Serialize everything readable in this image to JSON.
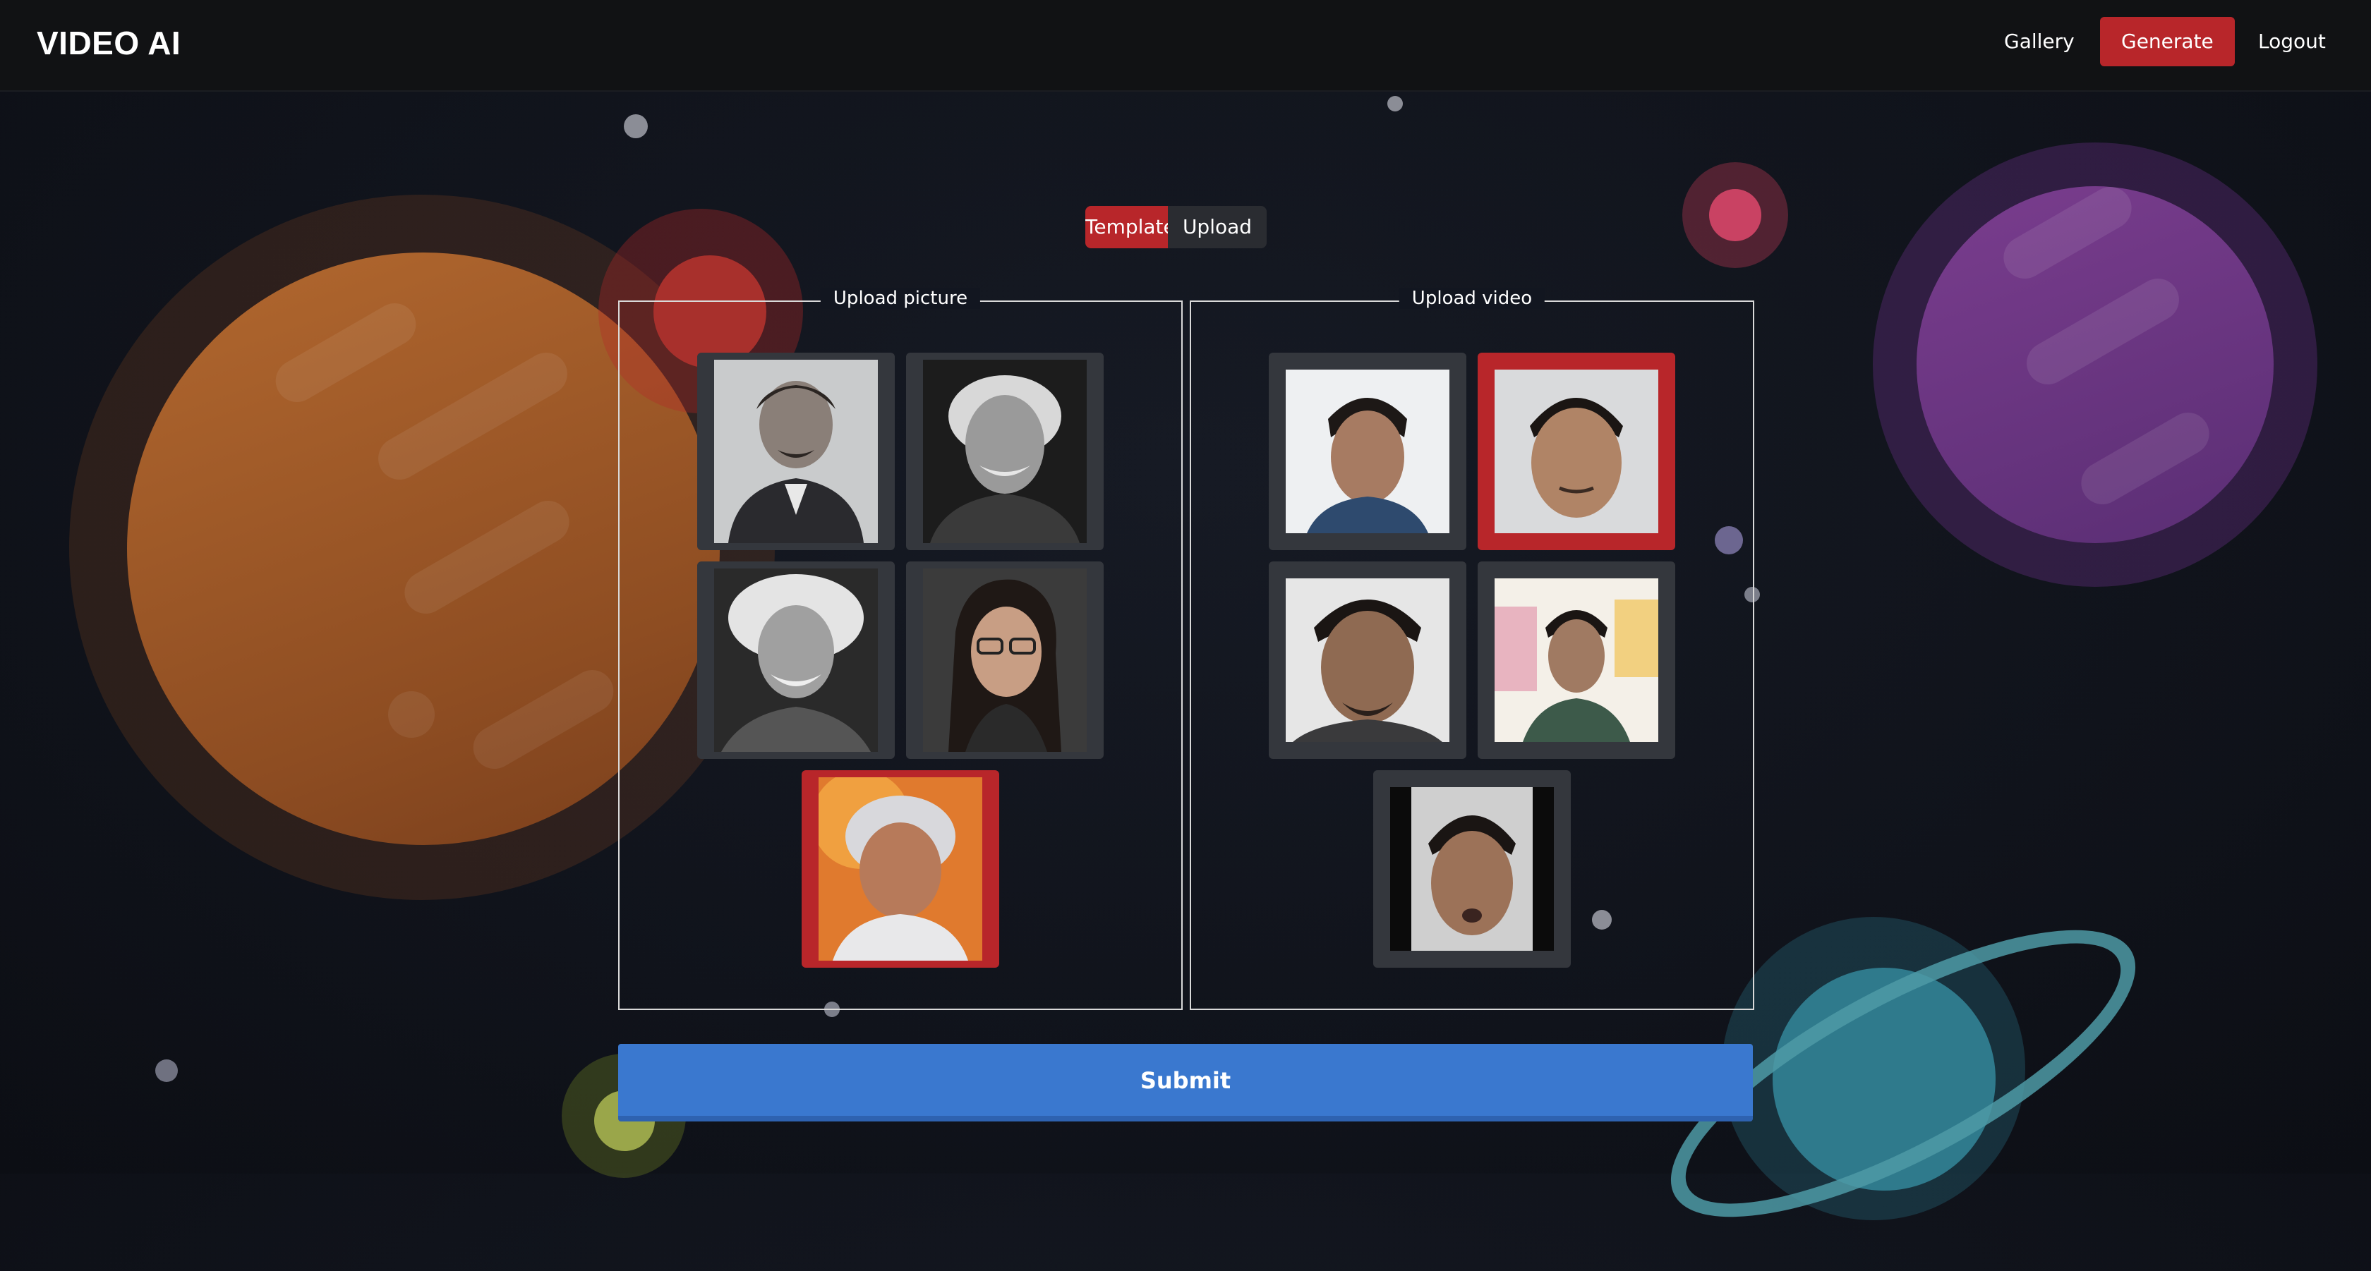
{
  "header": {
    "brand": "VIDEO AI",
    "nav": {
      "gallery": "Gallery",
      "generate": "Generate",
      "logout": "Logout"
    }
  },
  "mode_toggle": {
    "template": "Template",
    "upload": "Upload",
    "active": "Template"
  },
  "upload_picture": {
    "title": "Upload picture",
    "selected_index": 4,
    "items": [
      "portrait-1",
      "portrait-2",
      "portrait-3",
      "portrait-4",
      "portrait-5"
    ]
  },
  "upload_video": {
    "title": "Upload video",
    "selected_index": 1,
    "items": [
      "video-1",
      "video-2",
      "video-3",
      "video-4",
      "video-5"
    ]
  },
  "submit": {
    "label": "Submit"
  },
  "colors": {
    "accent_red": "#b8262a",
    "submit_blue": "#3a78cf",
    "tile_bg": "#34373d"
  }
}
